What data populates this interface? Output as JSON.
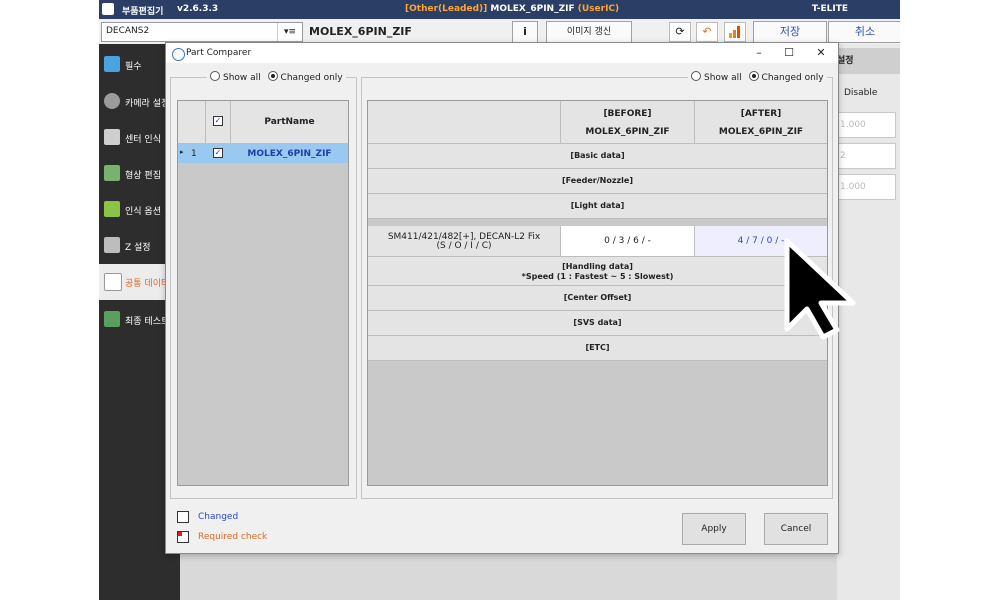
{
  "app": {
    "title": "부품편집기",
    "version": "v2.6.3.3",
    "title_bracket": "[Other(Leaded)]",
    "title_part": "MOLEX_6PIN_ZIF",
    "title_user": "(UserIC)",
    "brand": "T-ELITE"
  },
  "toolbar": {
    "machine_combo": "DECANS2",
    "combo_dropdown": "▾≡",
    "part_name": "MOLEX_6PIN_ZIF",
    "info_label": "i",
    "update_image_label": "이미지 갱신",
    "save_label": "저장",
    "cancel_label": "취소"
  },
  "sidebar": {
    "items": [
      {
        "label": "필수",
        "icon": "check-pencil-icon",
        "icon_color": "#4aa3df"
      },
      {
        "label": "카메라 설정",
        "icon": "camera-gear-icon",
        "icon_color": "#9b9b9b"
      },
      {
        "label": "센터 인식",
        "icon": "center-grid-icon",
        "icon_color": "#cfcfcf"
      },
      {
        "label": "형상 편집",
        "icon": "shape-edit-icon",
        "icon_color": "#77b36a"
      },
      {
        "label": "인식 옵션",
        "icon": "recognition-option-icon",
        "icon_color": "#8bc34a"
      },
      {
        "label": "Z 설정",
        "icon": "z-setting-icon",
        "icon_color": "#bdbdbd"
      },
      {
        "label": "공통 데이터",
        "icon": "common-data-icon",
        "icon_color": "#e0e0e0"
      },
      {
        "label": "최종 테스트",
        "icon": "final-test-icon",
        "icon_color": "#5aa05a"
      }
    ],
    "active_index": 6
  },
  "right_panel": {
    "header": "설정",
    "disable_label": "Disable",
    "fields": [
      "1.000",
      "2",
      "1.000"
    ]
  },
  "dialog": {
    "title": "Part Comparer",
    "left_filter": {
      "show_all": "Show all",
      "changed_only": "Changed only",
      "selected": "changed_only"
    },
    "right_filter": {
      "show_all": "Show all",
      "changed_only": "Changed only",
      "selected": "changed_only"
    },
    "part_table": {
      "header_partname": "PartName",
      "rows": [
        {
          "index": "1",
          "checked": true,
          "name": "MOLEX_6PIN_ZIF"
        }
      ]
    },
    "compare": {
      "before_header": "[BEFORE]",
      "before_part": "MOLEX_6PIN_ZIF",
      "after_header": "[AFTER]",
      "after_part": "MOLEX_6PIN_ZIF",
      "sections": {
        "basic": "[Basic data]",
        "feeder": "[Feeder/Nozzle]",
        "light": "[Light data]",
        "handling_1": "[Handling data]",
        "handling_2": "*Speed (1 : Fastest ~ 5 : Slowest)",
        "center": "[Center Offset]",
        "svs": "[SVS data]",
        "etc": "[ETC]"
      },
      "light_row": {
        "label_1": "SM411/421/482[+], DECAN-L2 Fix",
        "label_2": "(S / O / I / C)",
        "before": "0 / 3 / 6 / -",
        "after": "4 / 7 / 0 / -"
      }
    },
    "legend": {
      "changed": "Changed",
      "required": "Required check"
    },
    "apply_label": "Apply",
    "cancel_label": "Cancel"
  },
  "colors": {
    "titlebar": "#2a3e66",
    "accent_orange": "#ffa531",
    "changed_text": "#2a47c9",
    "required_text": "#e06a22",
    "selected_row": "#99c8f0",
    "after_cell": "#eeeeff"
  }
}
